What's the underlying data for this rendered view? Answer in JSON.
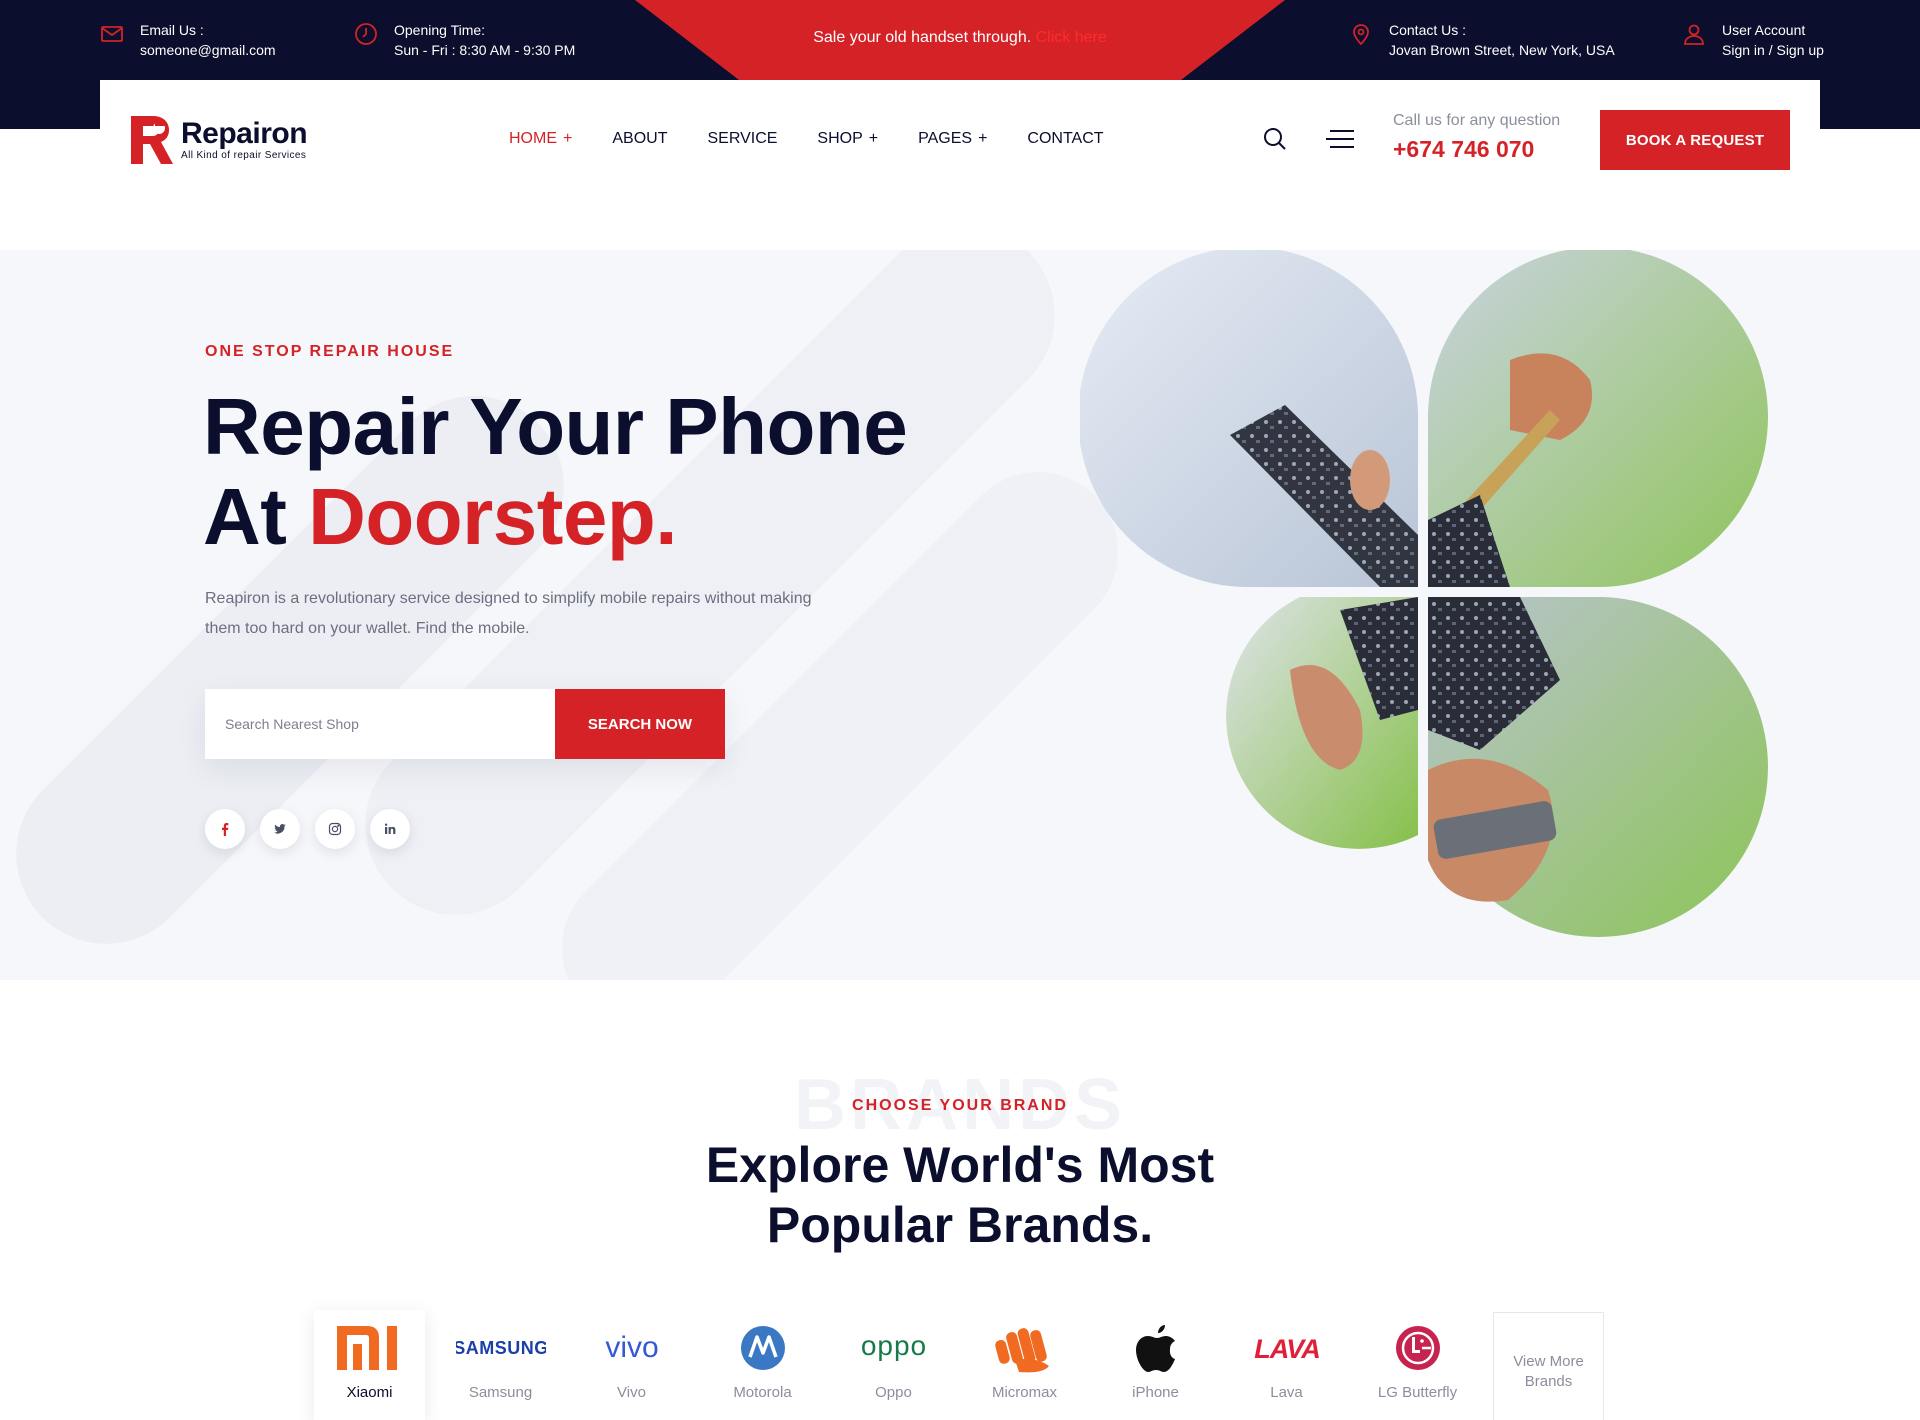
{
  "topbar": {
    "email_title": "Email Us :",
    "email_value": "someone@gmail.com",
    "hours_title": "Opening Time:",
    "hours_value": "Sun - Fri : 8:30 AM - 9:30 PM",
    "promo_text": "Sale your old handset through.",
    "promo_link": "Click here",
    "contact_title": "Contact Us :",
    "contact_value": "Jovan Brown Street, New York, USA",
    "account_title": "User Account",
    "account_value": "Sign in / Sign up"
  },
  "header": {
    "logo_name": "Repairon",
    "logo_tagline": "All Kind of repair Services",
    "nav": [
      {
        "label": "HOME",
        "plus": "+"
      },
      {
        "label": "ABOUT"
      },
      {
        "label": "SERVICE"
      },
      {
        "label": "SHOP",
        "plus": "+"
      },
      {
        "label": "PAGES",
        "plus": "+"
      },
      {
        "label": "CONTACT"
      }
    ],
    "call_question": "Call us for any question",
    "call_number": "+674 746 070",
    "book_button": "BOOK A REQUEST"
  },
  "hero": {
    "eyebrow": "ONE STOP REPAIR HOUSE",
    "title_line1": "Repair Your Phone",
    "title_line2_a": "At",
    "title_line2_b": "Doorstep.",
    "description": "Reapiron is a revolutionary service designed to simplify mobile repairs without making them too hard on your wallet. Find the mobile.",
    "search_placeholder": "Search Nearest Shop",
    "search_button": "SEARCH NOW",
    "socials": [
      "facebook-icon",
      "twitter-icon",
      "instagram-icon",
      "linkedin-icon"
    ]
  },
  "brands": {
    "bg_word": "BRANDS",
    "eyebrow": "CHOOSE YOUR BRAND",
    "title_line1": "Explore World's Most",
    "title_line2": "Popular Brands.",
    "items": [
      {
        "name": "Xiaomi",
        "logo": "MI"
      },
      {
        "name": "Samsung",
        "logo": "SAMSUNG"
      },
      {
        "name": "Vivo",
        "logo": "vivo"
      },
      {
        "name": "Motorola",
        "logo": "M"
      },
      {
        "name": "Oppo",
        "logo": "oppo"
      },
      {
        "name": "Micromax",
        "logo": "micromax-fist"
      },
      {
        "name": "iPhone",
        "logo": "apple"
      },
      {
        "name": "Lava",
        "logo": "LAVA"
      },
      {
        "name": "LG Butterfly",
        "logo": "LG"
      }
    ],
    "view_more": "View More Brands"
  },
  "colors": {
    "brand_red": "#d42226",
    "navy": "#0b0e2c",
    "muted": "#8b8e9c"
  }
}
